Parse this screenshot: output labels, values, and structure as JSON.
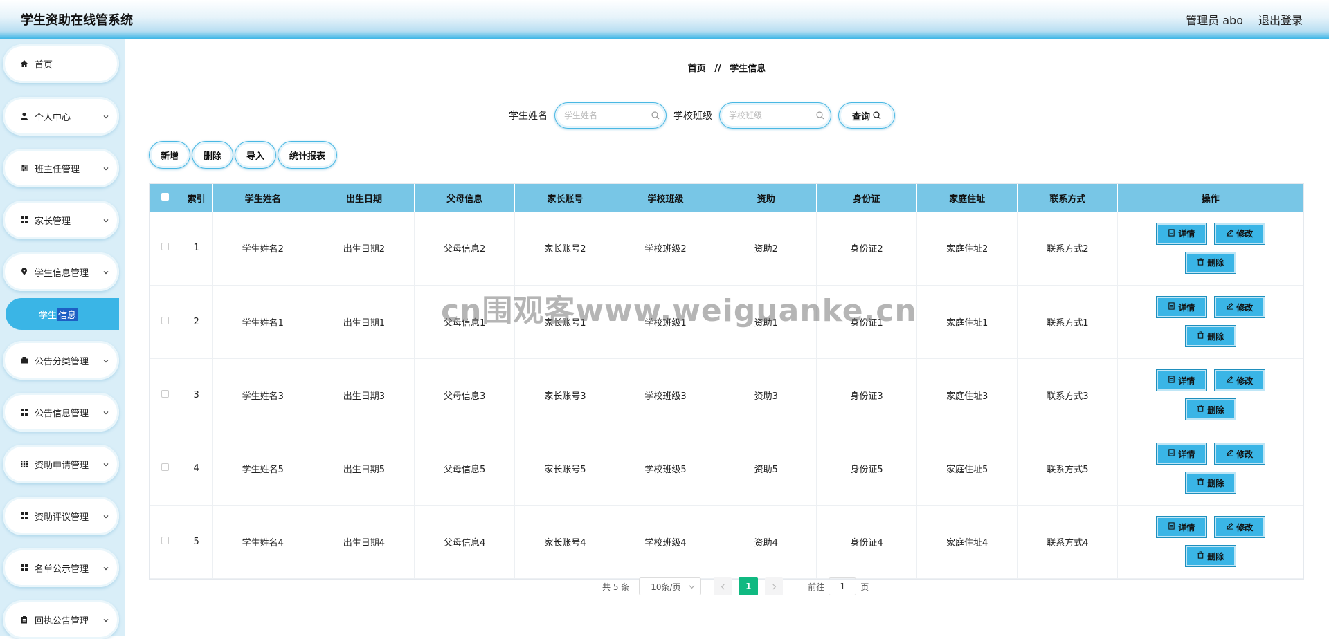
{
  "header": {
    "title": "学生资助在线管系统",
    "admin": "管理员 abo",
    "logout": "退出登录"
  },
  "sidebar": {
    "items": [
      {
        "label": "首页",
        "icon": "home-icon"
      },
      {
        "label": "个人中心",
        "icon": "user-icon"
      },
      {
        "label": "班主任管理",
        "icon": "sliders-icon"
      },
      {
        "label": "家长管理",
        "icon": "grid-icon"
      },
      {
        "label": "学生信息管理",
        "icon": "pin-icon"
      },
      {
        "label": "公告分类管理",
        "icon": "briefcase-icon"
      },
      {
        "label": "公告信息管理",
        "icon": "grid-icon"
      },
      {
        "label": "资助申请管理",
        "icon": "apps-icon"
      },
      {
        "label": "资助评议管理",
        "icon": "grid-icon"
      },
      {
        "label": "名单公示管理",
        "icon": "grid-icon"
      },
      {
        "label": "回执公告管理",
        "icon": "clipboard-icon"
      }
    ],
    "active_sub_a": "学生",
    "active_sub_b": "信息"
  },
  "breadcrumb": {
    "home": "首页",
    "sep": "//",
    "current": "学生信息"
  },
  "search": {
    "name_label": "学生姓名",
    "name_placeholder": "学生姓名",
    "class_label": "学校班级",
    "class_placeholder": "学校班级",
    "query": "查询"
  },
  "actions": {
    "add": "新增",
    "delete": "删除",
    "import": "导入",
    "report": "统计报表"
  },
  "table": {
    "headers": [
      "索引",
      "学生姓名",
      "出生日期",
      "父母信息",
      "家长账号",
      "学校班级",
      "资助",
      "身份证",
      "家庭住址",
      "联系方式",
      "操作"
    ],
    "rows": [
      [
        "1",
        "学生姓名2",
        "出生日期2",
        "父母信息2",
        "家长账号2",
        "学校班级2",
        "资助2",
        "身份证2",
        "家庭住址2",
        "联系方式2"
      ],
      [
        "2",
        "学生姓名1",
        "出生日期1",
        "父母信息1",
        "家长账号1",
        "学校班级1",
        "资助1",
        "身份证1",
        "家庭住址1",
        "联系方式1"
      ],
      [
        "3",
        "学生姓名3",
        "出生日期3",
        "父母信息3",
        "家长账号3",
        "学校班级3",
        "资助3",
        "身份证3",
        "家庭住址3",
        "联系方式3"
      ],
      [
        "4",
        "学生姓名5",
        "出生日期5",
        "父母信息5",
        "家长账号5",
        "学校班级5",
        "资助5",
        "身份证5",
        "家庭住址5",
        "联系方式5"
      ],
      [
        "5",
        "学生姓名4",
        "出生日期4",
        "父母信息4",
        "家长账号4",
        "学校班级4",
        "资助4",
        "身份证4",
        "家庭住址4",
        "联系方式4"
      ]
    ],
    "op_detail": "详情",
    "op_edit": "修改",
    "op_delete": "删除"
  },
  "pager": {
    "total": "共 5 条",
    "size": "10条/页",
    "current": "1",
    "goto": "前往",
    "goto_value": "1",
    "page": "页"
  },
  "watermark": "cn围观客www.weiguanke.cn",
  "colors": {
    "accent": "#3ab5e6",
    "header_row": "#78c6e6",
    "pager_active": "#10b981"
  }
}
